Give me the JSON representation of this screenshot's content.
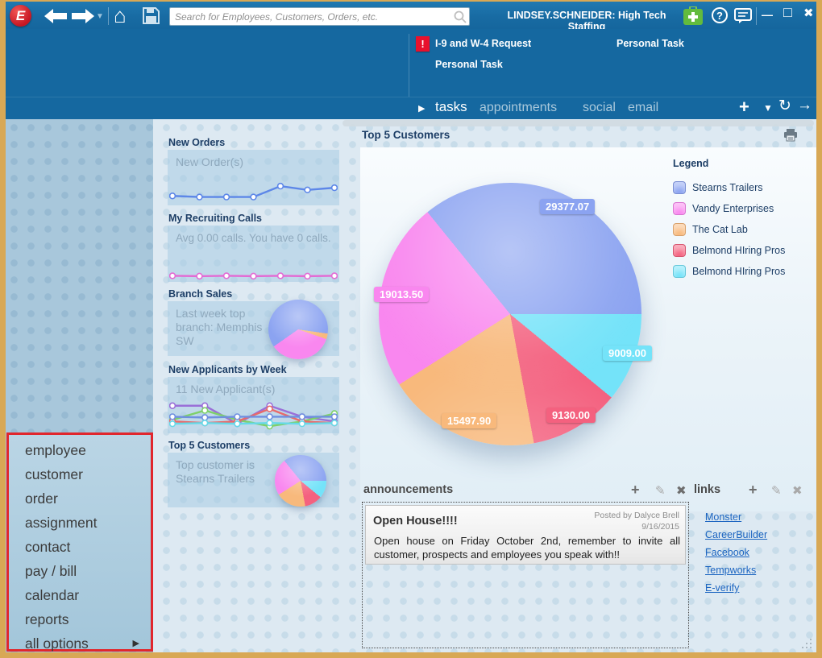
{
  "icons": {
    "play": "▶",
    "add": "+",
    "filter": "▼",
    "refresh": "↻",
    "open_arrow": "→",
    "home": "⌂",
    "dropdown": "▼",
    "minimize": "—",
    "maximize": "□",
    "close": "✖",
    "alert": "!",
    "edit": "✎",
    "delete": "✖",
    "submenu": "▶",
    "help": "?"
  },
  "titlebar": {
    "logo_letter": "E",
    "search_placeholder": "Search for Employees, Customers, Orders, etc.",
    "user_label": "LINDSEY.SCHNEIDER: High Tech Staffing"
  },
  "tasks_panel": {
    "items": [
      {
        "label": "I-9 and W-4 Request",
        "urgent": true
      },
      {
        "label": "Personal Task",
        "urgent": false
      },
      {
        "label": "Personal Task",
        "urgent": false
      }
    ],
    "tabs": [
      {
        "label": "tasks",
        "active": true
      },
      {
        "label": "appointments",
        "active": false
      },
      {
        "label": "social",
        "active": false
      },
      {
        "label": "email",
        "active": false
      }
    ]
  },
  "menu": {
    "items": [
      "employee",
      "customer",
      "order",
      "assignment",
      "contact",
      "pay / bill",
      "calendar",
      "reports",
      "all options"
    ]
  },
  "widgets": [
    {
      "title": "New Orders",
      "text": "New Order(s)",
      "spark": {
        "ymax": 40,
        "series": [
          {
            "color": "#5d87e8",
            "y": [
              30,
              32,
              32,
              32,
              12,
              19,
              15
            ]
          }
        ]
      }
    },
    {
      "title": "My Recruiting Calls",
      "text": "Avg 0.00 calls. You have 0 calls.",
      "spark": {
        "ymax": 40,
        "series": [
          {
            "color": "#e36bd4",
            "y": [
              34,
              35,
              34,
              35,
              34,
              35,
              34
            ]
          }
        ]
      }
    },
    {
      "title": "Branch Sales",
      "text": "Last week top branch: Memphis SW",
      "pie": {
        "colors": [
          "#8ba3f1",
          "#f8b97c",
          "#f987ef"
        ],
        "fractions": [
          0.62,
          0.03,
          0.35
        ],
        "from_deg": -125
      }
    },
    {
      "title": "New Applicants by Week",
      "text": "11 New Applicant(s)",
      "spark": {
        "ymax": 40,
        "series": [
          {
            "color": "#9a6fd8",
            "y": [
              10,
              10,
              33,
              10,
              24,
              30
            ]
          },
          {
            "color": "#7ed06a",
            "y": [
              28,
              16,
              28,
              36,
              30,
              20
            ]
          },
          {
            "color": "#e86a6a",
            "y": [
              30,
              32,
              30,
              14,
              30,
              32
            ]
          },
          {
            "color": "#6f8fe0",
            "y": [
              24,
              25,
              24,
              24,
              24,
              24
            ]
          },
          {
            "color": "#66d9e8",
            "y": [
              33,
              32,
              33,
              32,
              33,
              32
            ]
          }
        ]
      }
    },
    {
      "title": "Top 5 Customers",
      "text": "Top customer is Stearns Trailers"
    }
  ],
  "chart": {
    "title": "Top 5 Customers"
  },
  "chart_data": {
    "type": "pie",
    "title": "Top 5 Customers",
    "legend_title": "Legend",
    "legend_position": "right",
    "slices": [
      {
        "label": "Stearns Trailers",
        "value": 29377.07,
        "display": "29377.07",
        "color": "#8ba3f1"
      },
      {
        "label": "Vandy Enterprises",
        "value": 19013.5,
        "display": "19013.50",
        "color": "#f987ef"
      },
      {
        "label": "The Cat Lab",
        "value": 15497.9,
        "display": "15497.90",
        "color": "#f8b97c"
      },
      {
        "label": "Belmond HIring Pros",
        "value": 9130.0,
        "display": "9130.00",
        "color": "#f4617f"
      },
      {
        "label": "Belmond HIring Pros",
        "value": 9009.0,
        "display": "9009.00",
        "color": "#74e3f9"
      }
    ],
    "start_angle_deg": -39,
    "clockwise_draw_order": [
      0,
      4,
      3,
      2,
      1
    ]
  },
  "announcements": {
    "title": "announcements",
    "posts": [
      {
        "title": "Open House!!!!",
        "posted_by": "Posted by Dalyce Brell",
        "date": "9/16/2015",
        "body": "Open house on Friday October 2nd, remember to invite all customer, prospects and employees you speak with!!"
      }
    ]
  },
  "links": {
    "title": "links",
    "items": [
      "Monster",
      "CareerBuilder",
      "Facebook",
      "Tempworks",
      "E-verify"
    ]
  }
}
